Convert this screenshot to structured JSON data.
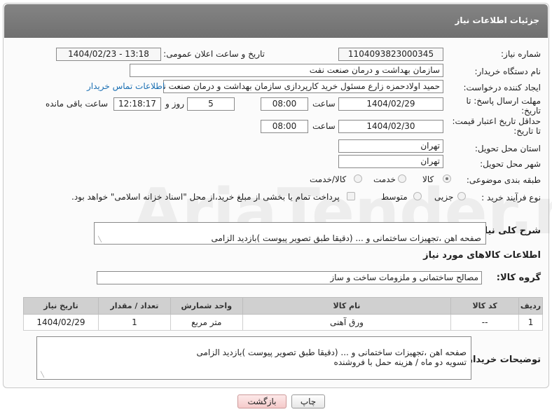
{
  "header": {
    "title": "جزئیات اطلاعات نیاز"
  },
  "watermark": "AriaTender.net",
  "form": {
    "need_number": {
      "label": "شماره نیاز:",
      "value": "1104093823000345"
    },
    "announce_datetime": {
      "label": "تاریخ و ساعت اعلان عمومی:",
      "value": "1404/02/23 - 13:18"
    },
    "buyer_org": {
      "label": "نام دستگاه خریدار:",
      "value": "سازمان بهداشت و درمان صنعت نفت"
    },
    "requester": {
      "label": "ایجاد کننده درخواست:",
      "value": "حمید اولادحمزه زارع مسئول خرید کارپردازی سازمان بهداشت و درمان صنعت نفت",
      "link": "اطلاعات تماس خریدار"
    },
    "response_deadline": {
      "label_line1": "مهلت ارسال پاسخ: تا",
      "label_line2": "تاریخ:",
      "date": "1404/02/29",
      "time_label": "ساعت",
      "time": "08:00",
      "days": "5",
      "days_label": "روز و",
      "remaining": "12:18:17",
      "remaining_label": "ساعت باقی مانده"
    },
    "price_validity": {
      "label_line1": "حداقل تاریخ اعتبار قیمت:",
      "label_line2": "تا تاریخ:",
      "date": "1404/02/30",
      "time_label": "ساعت",
      "time": "08:00"
    },
    "delivery_province": {
      "label": "استان محل تحویل:",
      "value": "تهران"
    },
    "delivery_city": {
      "label": "شهر محل تحویل:",
      "value": "تهران"
    },
    "category": {
      "label": "طبقه بندی موضوعی:",
      "options": [
        "کالا",
        "خدمت",
        "کالا/خدمت"
      ],
      "selected": "کالا"
    },
    "purchase_type": {
      "label": "نوع فرآیند خرید :",
      "options": [
        "جزیی",
        "متوسط"
      ],
      "selected": "",
      "checkbox_text": "پرداخت تمام یا بخشی از مبلغ خرید،از محل \"اسناد خزانه اسلامی\" خواهد بود."
    },
    "description": {
      "label": "شرح کلی نیاز:",
      "text": "صفحه اهن ،تجهیزات ساختمانی  و ... (دقیقا طبق تصویر پیوست )بازدید الزامی\nتسویه دو ماه / هزینه حمل با فروشنده"
    }
  },
  "goods": {
    "section_title": "اطلاعات کالاهای مورد نیاز",
    "group_label": "گروه کالا:",
    "group_value": "مصالح ساختمانی و ملزومات ساخت و ساز",
    "columns": [
      "ردیف",
      "کد کالا",
      "نام کالا",
      "واحد شمارش",
      "تعداد / مقدار",
      "تاریخ نیاز"
    ],
    "rows": [
      [
        "1",
        "--",
        "ورق آهنی",
        "متر مربع",
        "1",
        "1404/02/29"
      ]
    ]
  },
  "buyer_notes": {
    "label": "توضیحات خریدار:",
    "text": "صفحه اهن ،تجهیزات ساختمانی  و ... (دقیقا طبق تصویر پیوست )بازدید الزامی\nتسویه دو ماه / هزینه حمل با فروشنده"
  },
  "buttons": {
    "print": "چاپ",
    "back": "بازگشت"
  }
}
